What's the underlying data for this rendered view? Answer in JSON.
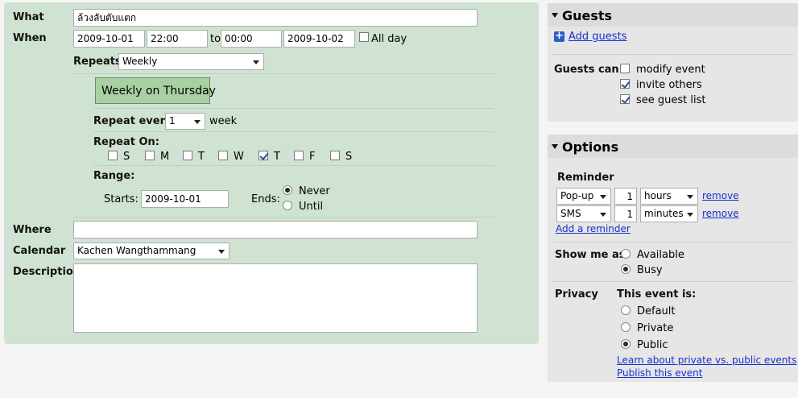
{
  "form": {
    "what_label": "What",
    "what_value": "ล้วงลับตับแตก",
    "when_label": "When",
    "start_date": "2009-10-01",
    "start_time": "22:00",
    "to_label": "to",
    "end_time": "00:00",
    "end_date": "2009-10-02",
    "allday_label": "All day",
    "repeats_label": "Repeats:",
    "repeats_value": "Weekly",
    "summary": "Weekly on Thursday",
    "repeat_every_label": "Repeat every:",
    "repeat_every_value": "1",
    "repeat_every_unit": "week",
    "repeat_on_label": "Repeat On:",
    "days": [
      {
        "label": "S",
        "checked": false
      },
      {
        "label": "M",
        "checked": false
      },
      {
        "label": "T",
        "checked": false
      },
      {
        "label": "W",
        "checked": false
      },
      {
        "label": "T",
        "checked": true
      },
      {
        "label": "F",
        "checked": false
      },
      {
        "label": "S",
        "checked": false
      }
    ],
    "range_label": "Range:",
    "starts_label": "Starts:",
    "starts_value": "2009-10-01",
    "ends_label": "Ends:",
    "ends_never": "Never",
    "ends_until": "Until",
    "where_label": "Where",
    "where_value": "",
    "calendar_label": "Calendar",
    "calendar_value": "Kachen Wangthammang",
    "description_label": "Description",
    "description_value": ""
  },
  "guests": {
    "title": "Guests",
    "add_guests": "Add guests",
    "guests_can_label": "Guests can",
    "options": [
      {
        "label": "modify event",
        "checked": false
      },
      {
        "label": "invite others",
        "checked": true
      },
      {
        "label": "see guest list",
        "checked": true
      }
    ]
  },
  "options": {
    "title": "Options",
    "reminder_label": "Reminder",
    "reminders": [
      {
        "method": "Pop-up",
        "amount": "1",
        "unit": "hours",
        "remove": "remove"
      },
      {
        "method": "SMS",
        "amount": "1",
        "unit": "minutes",
        "remove": "remove"
      }
    ],
    "add_reminder": "Add a reminder",
    "show_me_as_label": "Show me as",
    "available": "Available",
    "busy": "Busy",
    "privacy_label": "Privacy",
    "this_event_is": "This event is:",
    "privacy_default": "Default",
    "privacy_private": "Private",
    "privacy_public": "Public",
    "learn_link": "Learn about private vs. public events",
    "publish_link": "Publish this event"
  }
}
